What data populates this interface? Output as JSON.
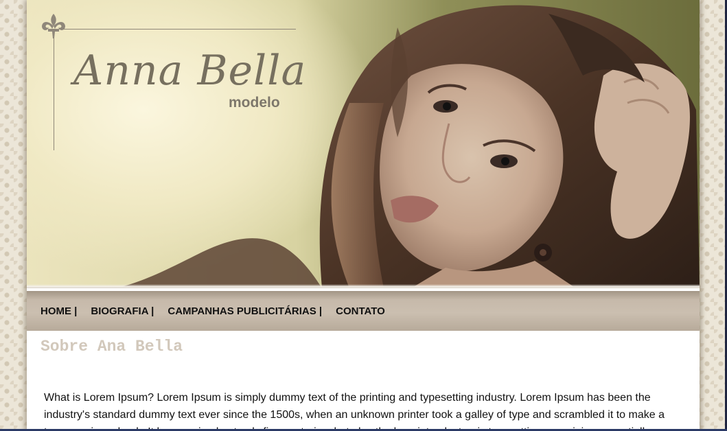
{
  "header": {
    "logo_title": "Anna Bella",
    "logo_subtitle": "modelo",
    "fleur_icon": "fleur-de-lis-icon",
    "photo": "model-portrait-photo"
  },
  "nav": {
    "items": [
      {
        "label": "HOME |"
      },
      {
        "label": "BIOGRAFIA |"
      },
      {
        "label": "CAMPANHAS PUBLICITÁRIAS |"
      },
      {
        "label": "CONTATO"
      }
    ]
  },
  "main": {
    "title": "Sobre Ana Bella",
    "paragraph": "What is Lorem Ipsum? Lorem Ipsum is simply dummy text of the printing and typesetting industry. Lorem Ipsum has been the industry's standard dummy text ever since the 1500s, when an unknown printer took a galley of type and scrambled it to make a type specimen book. It has survived not only five centuries, but also the leap into electronic typesetting, remaining essentially"
  },
  "colors": {
    "background": "#ece6d8",
    "nav_bar": "#c6b9aa",
    "title_text": "#d2c8bb",
    "logo_text": "#77705f"
  }
}
